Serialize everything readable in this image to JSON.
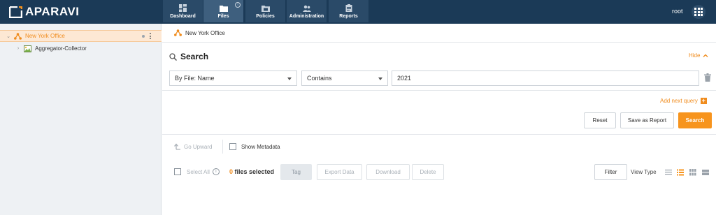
{
  "brand": {
    "name": "APARAVI"
  },
  "nav": {
    "tabs": [
      {
        "label": "Dashboard",
        "icon": "dashboard-icon"
      },
      {
        "label": "Files",
        "icon": "folder-icon",
        "active": true
      },
      {
        "label": "Policies",
        "icon": "policies-icon"
      },
      {
        "label": "Administration",
        "icon": "users-icon"
      },
      {
        "label": "Reports",
        "icon": "clipboard-icon"
      }
    ],
    "user": "root"
  },
  "sidebar": {
    "items": [
      {
        "label": "New York Office",
        "selected": true,
        "icon": "network-icon"
      },
      {
        "label": "Aggregator-Collector",
        "icon": "server-image-icon"
      }
    ]
  },
  "breadcrumb": {
    "label": "New York Office"
  },
  "search": {
    "title": "Search",
    "hide_label": "Hide",
    "field_select": "By File: Name",
    "operator_select": "Contains",
    "query_value": "2021",
    "add_query_label": "Add next query",
    "reset_label": "Reset",
    "save_report_label": "Save as Report",
    "search_label": "Search"
  },
  "results": {
    "go_upward_label": "Go Upward",
    "show_metadata_label": "Show Metadata",
    "select_all_label": "Select All",
    "selected_count": "0",
    "selected_suffix": " files selected",
    "tag_label": "Tag",
    "export_label": "Export Data",
    "download_label": "Download",
    "delete_label": "Delete",
    "filter_label": "Filter",
    "view_type_label": "View Type"
  },
  "colors": {
    "accent": "#f7941d",
    "topbar": "#1b3a57"
  }
}
